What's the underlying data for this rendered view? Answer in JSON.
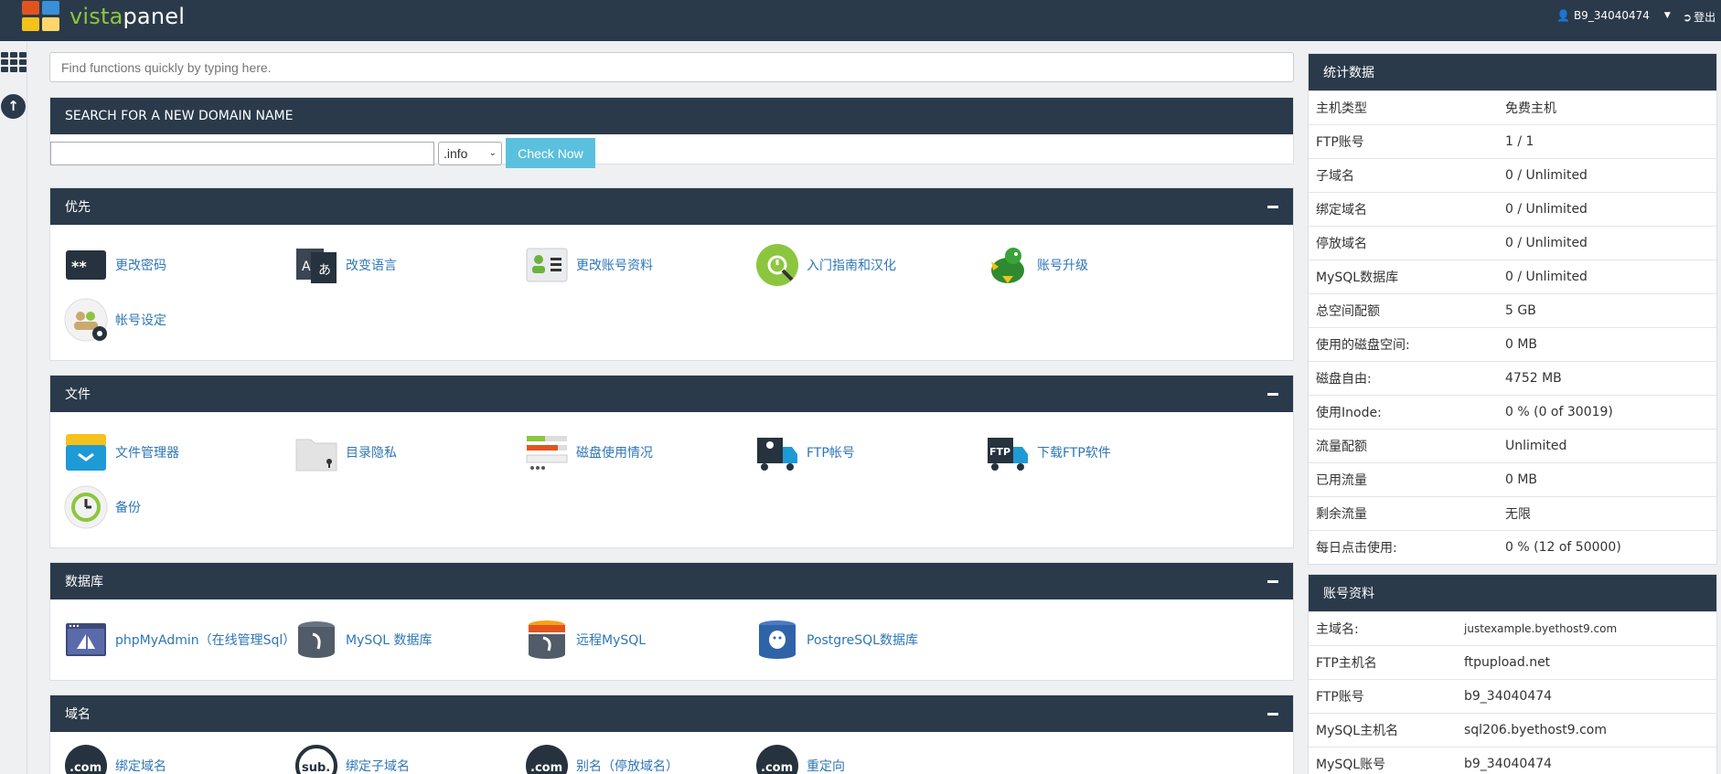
{
  "brand": {
    "vista": "vista",
    "panel": "panel"
  },
  "user": {
    "name": "B9_34040474",
    "logout": "登出"
  },
  "search": {
    "placeholder": "Find functions quickly by typing here."
  },
  "domain_search": {
    "title": "SEARCH FOR A NEW DOMAIN NAME",
    "tld": ".info",
    "button": "Check Now"
  },
  "sections": {
    "priority": {
      "title": "优先",
      "items": [
        "更改密码",
        "改变语言",
        "更改账号资料",
        "入门指南和汉化",
        "账号升级",
        "帐号设定"
      ]
    },
    "files": {
      "title": "文件",
      "items": [
        "文件管理器",
        "目录隐私",
        "磁盘使用情况",
        "FTP帐号",
        "下载FTP软件",
        "备份"
      ]
    },
    "database": {
      "title": "数据库",
      "items": [
        "phpMyAdmin（在线管理Sql）",
        "MySQL 数据库",
        "远程MySQL",
        "PostgreSQL数据库"
      ]
    },
    "domains": {
      "title": "域名",
      "items": [
        "绑定域名",
        "绑定子域名",
        "别名（停放域名）",
        "重定向"
      ]
    }
  },
  "icons": {
    "ftp": "FTP",
    "com": ".com",
    "sub": "sub.",
    "keys": "**",
    "lang_a": "A",
    "lang_jp": "あ"
  },
  "stats": {
    "title": "统计数据",
    "rows": [
      {
        "k": "主机类型",
        "v": "免费主机"
      },
      {
        "k": "FTP账号",
        "v": "1 / 1"
      },
      {
        "k": "子域名",
        "v": "0 / Unlimited"
      },
      {
        "k": "绑定域名",
        "v": "0 / Unlimited"
      },
      {
        "k": "停放域名",
        "v": "0 / Unlimited"
      },
      {
        "k": "MySQL数据库",
        "v": "0 / Unlimited"
      },
      {
        "k": "总空间配额",
        "v": "5 GB"
      },
      {
        "k": "使用的磁盘空间:",
        "v": "0 MB"
      },
      {
        "k": "磁盘自由:",
        "v": "4752 MB"
      },
      {
        "k": "使用Inode:",
        "v": "0 % (0 of 30019)"
      },
      {
        "k": "流量配额",
        "v": "Unlimited"
      },
      {
        "k": "已用流量",
        "v": "0 MB"
      },
      {
        "k": "剩余流量",
        "v": "无限"
      },
      {
        "k": "每日点击使用:",
        "v": "0 % (12 of 50000)"
      }
    ]
  },
  "account": {
    "title": "账号资料",
    "rows": [
      {
        "k": "主域名:",
        "v": "justexample.byethost9.com"
      },
      {
        "k": "FTP主机名",
        "v": "ftpupload.net"
      },
      {
        "k": "FTP账号",
        "v": "b9_34040474"
      },
      {
        "k": "MySQL主机名",
        "v": "sql206.byethost9.com"
      },
      {
        "k": "MySQL账号",
        "v": "b9_34040474"
      }
    ]
  },
  "colors": {
    "header": "#2b3a4a",
    "link": "#2e76b7",
    "button": "#5bc0de",
    "accent": "#8cc63f"
  }
}
